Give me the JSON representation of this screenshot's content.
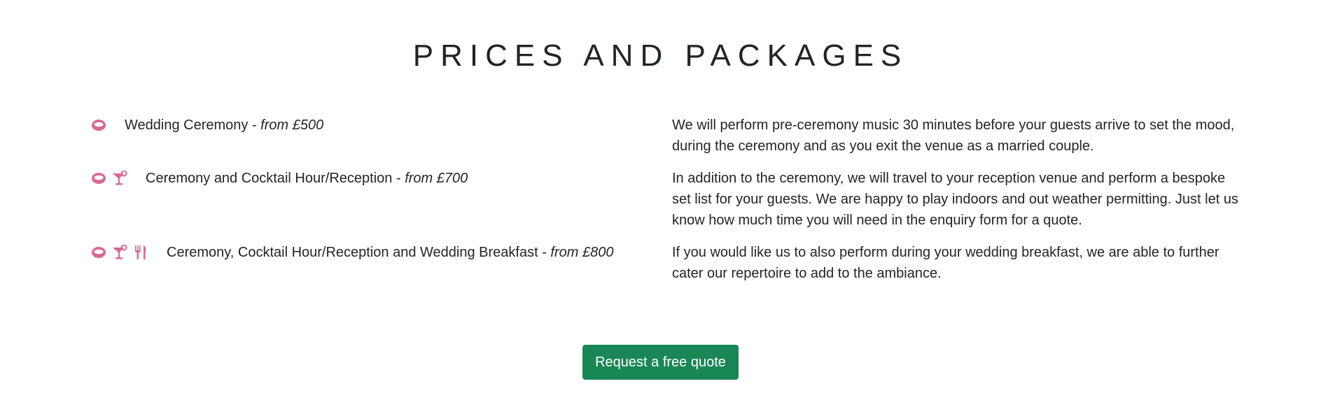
{
  "title": "PRICES AND PACKAGES",
  "colors": {
    "icon": "#d9698f",
    "button": "#198754",
    "text": "#212529"
  },
  "packages": [
    {
      "icons": [
        "ring-icon"
      ],
      "name": "Wedding Ceremony",
      "separator": " - ",
      "price": "from £500",
      "description": "We will perform pre-ceremony music 30 minutes before your guests arrive to set the mood, during the ceremony and as you exit the venue as a married couple."
    },
    {
      "icons": [
        "ring-icon",
        "cocktail-icon"
      ],
      "name": "Ceremony and Cocktail Hour/Reception",
      "separator": " - ",
      "price": "from £700",
      "description": "In addition to the ceremony, we will travel to your reception venue and perform a bespoke set list for your guests. We are happy to play indoors and out weather permitting. Just let us know how much time you will need in the enquiry form for a quote."
    },
    {
      "icons": [
        "ring-icon",
        "cocktail-icon",
        "utensils-icon"
      ],
      "name": "Ceremony, Cocktail Hour/Reception and Wedding Breakfast",
      "separator": " - ",
      "price": "from £800",
      "description": "If you would like us to also perform during your wedding breakfast, we are able to further cater our repertoire to add to the ambiance."
    }
  ],
  "cta": {
    "label": "Request a free quote"
  }
}
